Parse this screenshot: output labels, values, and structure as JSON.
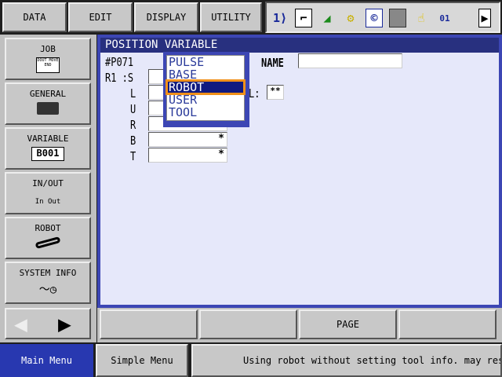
{
  "menu": [
    "DATA",
    "EDIT",
    "DISPLAY",
    "UTILITY"
  ],
  "status_icons": [
    "1-2-icon",
    "coordinate-icon",
    "speed-icon",
    "mode-icon",
    "teach-icon",
    "page-icon",
    "hand-icon",
    "tool-01-icon"
  ],
  "sidebar": [
    {
      "label": "JOB",
      "icon": "job-icon",
      "icon_text": "DOUT MOVE END"
    },
    {
      "label": "GENERAL",
      "icon": "general-icon"
    },
    {
      "label": "VARIABLE",
      "icon": "variable-icon",
      "icon_text": "B001"
    },
    {
      "label": "IN/OUT",
      "icon": "in-out-icon",
      "icon_text": "In  Out"
    },
    {
      "label": "ROBOT",
      "icon": "robot-icon"
    },
    {
      "label": "SYSTEM INFO",
      "icon": "system-info-icon"
    }
  ],
  "panel": {
    "title": "POSITION VARIABLE",
    "var_id": "#P071",
    "name_label": "NAME",
    "name_value": "",
    "axes": [
      {
        "label": "R1 :S",
        "value": ""
      },
      {
        "label": "L",
        "value": ""
      },
      {
        "label": "U",
        "value": ""
      },
      {
        "label": "R",
        "value": ""
      },
      {
        "label": "B",
        "value": "*"
      },
      {
        "label": "T",
        "value": "*"
      }
    ],
    "tool_label": "L:",
    "tool_value": "**",
    "dropdown": {
      "options": [
        "PULSE",
        "BASE",
        "ROBOT",
        "USER",
        "TOOL"
      ],
      "selected": "ROBOT"
    }
  },
  "bottom_buttons": [
    "",
    "",
    "PAGE",
    ""
  ],
  "footer": {
    "main_menu": "Main Menu",
    "simple_menu": "Simple Menu",
    "message": "Using robot without setting tool info. may resu"
  },
  "colors": {
    "accent": "#3c46b4",
    "title": "#28307f",
    "selection": "#101a80",
    "highlight": "#f0901a"
  }
}
